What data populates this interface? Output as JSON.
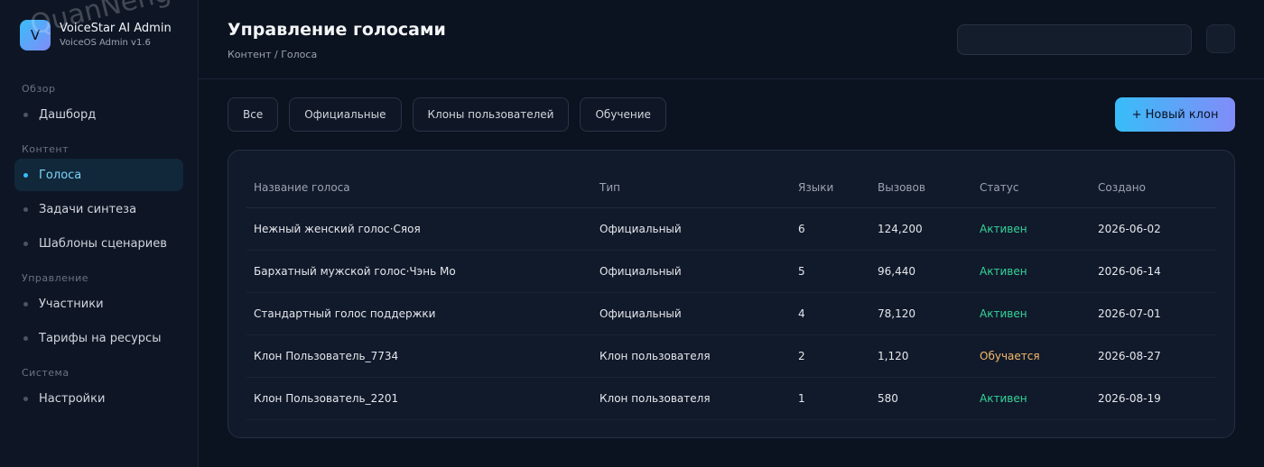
{
  "brand": {
    "logo_letter": "V",
    "name": "VoiceStar AI Admin",
    "version": "VoiceOS Admin v1.6"
  },
  "sidebar": {
    "sections": [
      {
        "title": "Обзор",
        "items": [
          {
            "label": "Дашборд",
            "active": false
          }
        ]
      },
      {
        "title": "Контент",
        "items": [
          {
            "label": "Голоса",
            "active": true
          },
          {
            "label": "Задачи синтеза",
            "active": false
          },
          {
            "label": "Шаблоны сценариев",
            "active": false
          }
        ]
      },
      {
        "title": "Управление",
        "items": [
          {
            "label": "Участники",
            "active": false
          },
          {
            "label": "Тарифы на ресурсы",
            "active": false
          }
        ]
      },
      {
        "title": "Система",
        "items": [
          {
            "label": "Настройки",
            "active": false
          }
        ]
      }
    ]
  },
  "header": {
    "title": "Управление голосами",
    "breadcrumb": "Контент / Голоса"
  },
  "filters": [
    "Все",
    "Официальные",
    "Клоны пользователей",
    "Обучение"
  ],
  "new_clone_label": "+ Новый клон",
  "table": {
    "columns": [
      "Название голоса",
      "Тип",
      "Языки",
      "Вызовов",
      "Статус",
      "Создано"
    ],
    "rows": [
      {
        "name": "Нежный женский голос·Сяоя",
        "type": "Официальный",
        "languages": "6",
        "calls": "124,200",
        "status": "Активен",
        "status_kind": "active",
        "created": "2026-06-02"
      },
      {
        "name": "Бархатный мужской голос·Чэнь Мо",
        "type": "Официальный",
        "languages": "5",
        "calls": "96,440",
        "status": "Активен",
        "status_kind": "active",
        "created": "2026-06-14"
      },
      {
        "name": "Стандартный голос поддержки",
        "type": "Официальный",
        "languages": "4",
        "calls": "78,120",
        "status": "Активен",
        "status_kind": "active",
        "created": "2026-07-01"
      },
      {
        "name": "Клон Пользователь_7734",
        "type": "Клон пользователя",
        "languages": "2",
        "calls": "1,120",
        "status": "Обучается",
        "status_kind": "training",
        "created": "2026-08-27"
      },
      {
        "name": "Клон Пользователь_2201",
        "type": "Клон пользователя",
        "languages": "1",
        "calls": "580",
        "status": "Активен",
        "status_kind": "active",
        "created": "2026-08-19"
      }
    ]
  },
  "watermark": "QuanNeng YuanMa · inzyxuashop.com",
  "colors": {
    "accent": "#38bdf8",
    "accent_end": "#818cf8",
    "status_active": "#34d399",
    "status_training": "#f5b969"
  }
}
